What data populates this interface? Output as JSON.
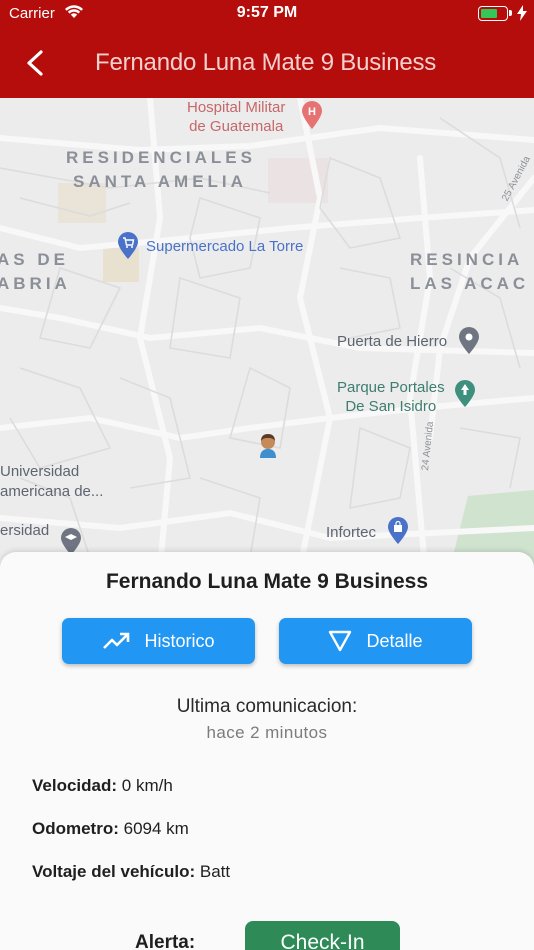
{
  "status_bar": {
    "carrier": "Carrier",
    "time": "9:57 PM",
    "battery_level": 0.7
  },
  "app_bar": {
    "title": "Fernando Luna Mate 9 Business"
  },
  "map": {
    "areas": {
      "residenciales_1": "RESIDENCIALES",
      "residenciales_2": "SANTA AMELIA",
      "left_1": "AS DE",
      "left_2": "ABRIA",
      "right_1": "RESINCIA",
      "right_2": "LAS ACAC"
    },
    "pois": {
      "hospital_1": "Hospital Militar",
      "hospital_2": "de Guatemala",
      "supermercado": "Supermercado La Torre",
      "puerta": "Puerta de Hierro",
      "parque_1": "Parque Portales",
      "parque_2": "De San Isidro",
      "universidad_1": "Universidad",
      "universidad_2": "americana de...",
      "universidad2": "ersidad",
      "infortec": "Infortec"
    },
    "streets": {
      "avenida_25": "25 Avenida",
      "avenida_24": "24 Avenida"
    }
  },
  "sheet": {
    "vehicle_name": "Fernando Luna Mate 9 Business",
    "historico_label": "Historico",
    "detalle_label": "Detalle",
    "last_comm_label": "Ultima comunicacion:",
    "last_comm_value": "hace 2 minutos",
    "velocidad_label": "Velocidad:",
    "velocidad_value": "0 km/h",
    "odometro_label": "Odometro:",
    "odometro_value": "6094 km",
    "voltaje_label": "Voltaje del vehículo:",
    "voltaje_value": "Batt",
    "alerta_label": "Alerta:",
    "checkin_label": "Check-In"
  },
  "colors": {
    "app_bar": "#b50d0b",
    "primary_button": "#2196f3",
    "checkin_button": "#2e8b57"
  }
}
